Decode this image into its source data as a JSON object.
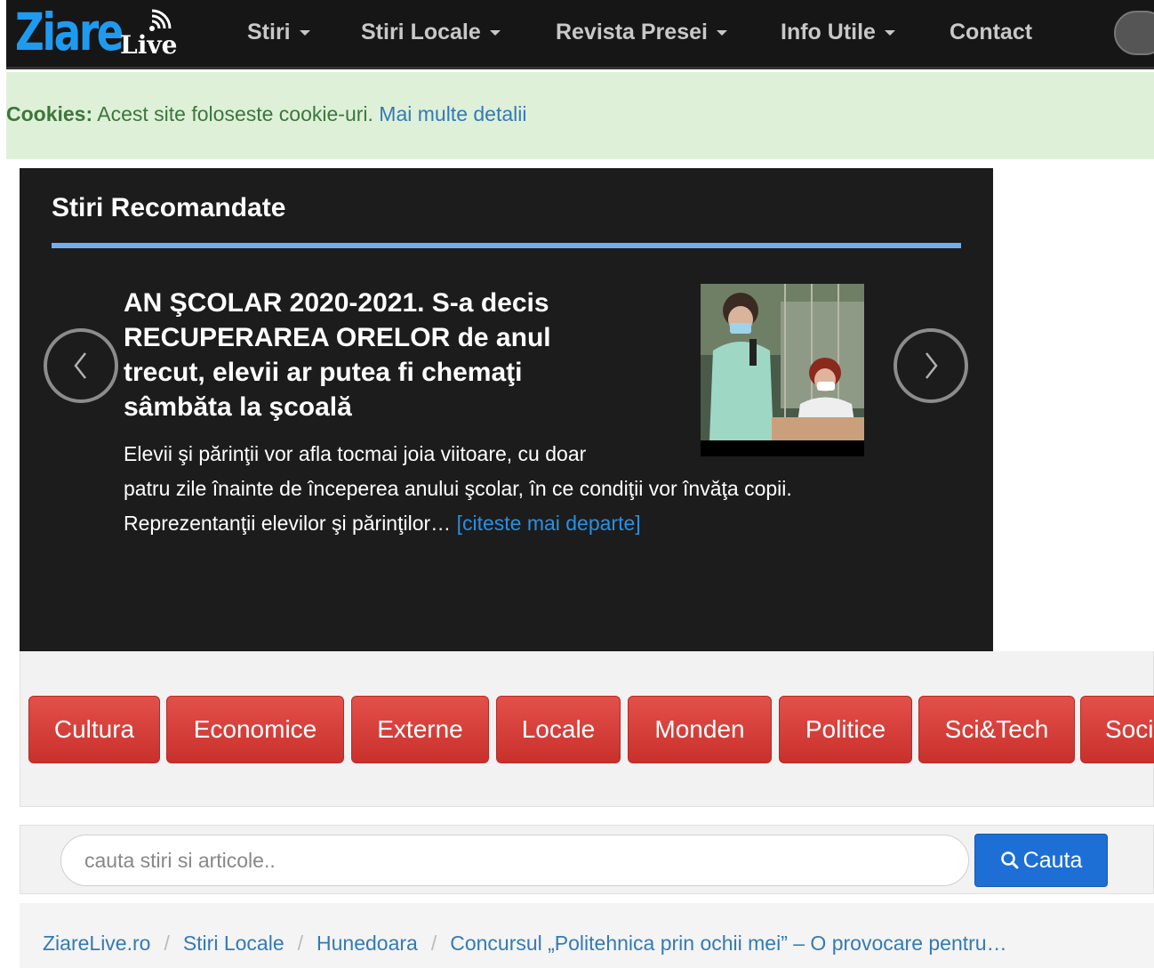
{
  "logo": {
    "main": "Ziare",
    "sub": "Live",
    "icon": "wifi-signal-icon"
  },
  "nav": {
    "items": [
      {
        "label": "Stiri",
        "dropdown": true
      },
      {
        "label": "Stiri Locale",
        "dropdown": true
      },
      {
        "label": "Revista Presei",
        "dropdown": true
      },
      {
        "label": "Info Utile",
        "dropdown": true
      },
      {
        "label": "Contact",
        "dropdown": false
      }
    ]
  },
  "cookies": {
    "label": "Cookies:",
    "text": " Acest site foloseste cookie-uri. ",
    "link": "Mai multe detalii"
  },
  "recommended": {
    "title": "Stiri Recomandate",
    "article": {
      "headline": "AN ŞCOLAR 2020-2021. S-a decis RECUPERAREA ORELOR de anul trecut, elevii ar putea fi chemaţi sâmbăta la şcoală",
      "excerpt_line1": "Elevii şi părinţii vor afla tocmai joia viitoare, cu doar",
      "excerpt_rest": "patru zile înainte de începerea anului şcolar, în ce condiţii vor învăţa copii. Reprezentanţii elevilor şi părinţilor… ",
      "read_more": "[citeste mai departe]"
    }
  },
  "categories": [
    "Cultura",
    "Economice",
    "Externe",
    "Locale",
    "Monden",
    "Politice",
    "Sci&Tech",
    "Soci"
  ],
  "search": {
    "placeholder": "cauta stiri si articole..",
    "button": "Cauta"
  },
  "breadcrumb": [
    "ZiareLive.ro",
    "Stiri Locale",
    "Hunedoara",
    "Concursul „Politehnica prin ochii mei” – O provocare pentru…"
  ],
  "colors": {
    "accent": "#1e9bf0",
    "category_red": "#d9534f",
    "search_blue": "#1d6fd6",
    "rule_blue": "#72afef"
  }
}
